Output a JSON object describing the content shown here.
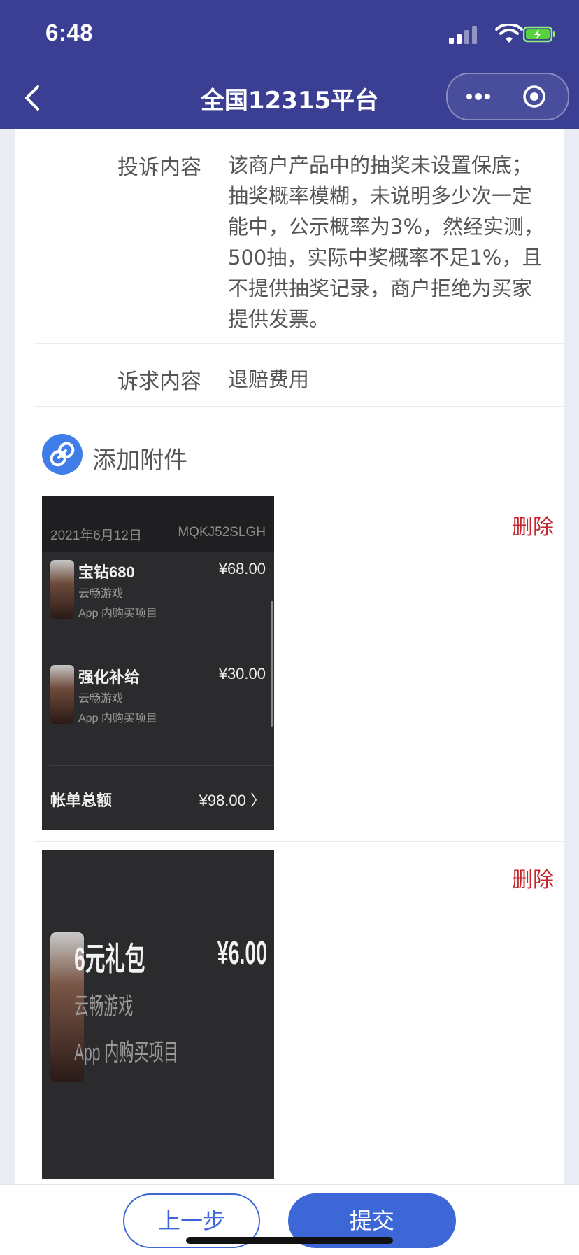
{
  "status_bar": {
    "time": "6:48"
  },
  "nav": {
    "title": "全国12315平台"
  },
  "complaint": {
    "content_label": "投诉内容",
    "content_value": "该商户产品中的抽奖未设置保底；抽奖概率模糊，未说明多少次一定能中，公示概率为3%，然经实测，500抽，实际中奖概率不足1%，且不提供抽奖记录，商户拒绝为买家提供发票。",
    "demand_label": "诉求内容",
    "demand_value": "退赔费用"
  },
  "attachments": {
    "add_label": "添加附件",
    "delete_label": "删除",
    "receipt1": {
      "date": "2021年6月12日",
      "order_id": "MQKJ52SLGH",
      "items": [
        {
          "name": "宝钻680",
          "developer": "云畅游戏",
          "type": "App 内购买项目",
          "price": "¥68.00"
        },
        {
          "name": "强化补给",
          "developer": "云畅游戏",
          "type": "App 内购买项目",
          "price": "¥30.00"
        }
      ],
      "total_label": "帐单总额",
      "total_value": "¥98.00 〉"
    },
    "receipt2": {
      "name": "6元礼包",
      "developer": "云畅游戏",
      "type": "App 内购买项目",
      "price": "¥6.00"
    }
  },
  "bottom": {
    "prev_label": "上一步",
    "submit_label": "提交"
  },
  "colors": {
    "header": "#3a3f94",
    "primary": "#3d67d6",
    "delete": "#c6262e"
  }
}
